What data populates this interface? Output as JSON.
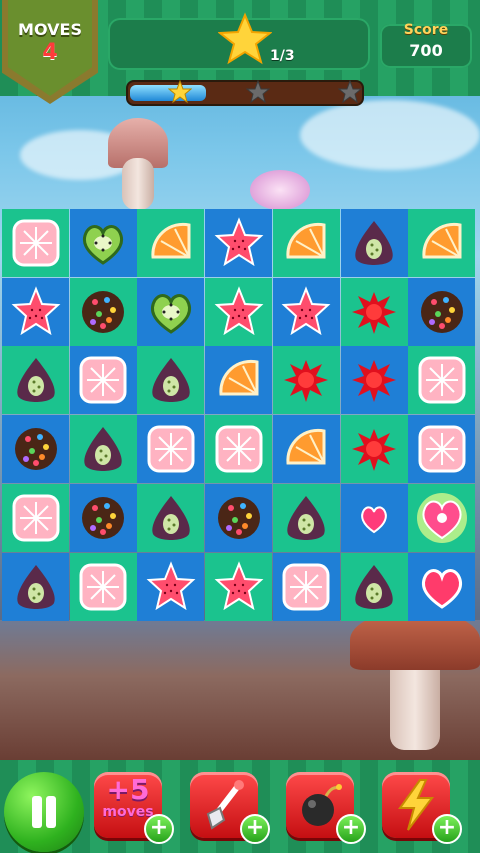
{
  "hud": {
    "moves_label": "MOVES",
    "moves_value": "4",
    "stars_text": "1/3",
    "score_label": "Score",
    "score_value": "700",
    "progress_fraction": 0.33,
    "progress_stars_earned": 1
  },
  "board": {
    "rows": [
      [
        "grapefruit",
        "kiwi-heart",
        "orange-slice",
        "star-jelly",
        "orange-slice",
        "grape-drop",
        "orange-slice"
      ],
      [
        "star-jelly",
        "choco-sprinkle",
        "kiwi-heart",
        "star-jelly",
        "star-jelly",
        "red-splat",
        "choco-sprinkle"
      ],
      [
        "grape-drop",
        "grapefruit",
        "grape-drop",
        "orange-slice",
        "red-splat",
        "red-splat",
        "grapefruit"
      ],
      [
        "choco-sprinkle",
        "grape-drop",
        "grapefruit",
        "grapefruit",
        "orange-slice",
        "red-splat",
        "grapefruit"
      ],
      [
        "grapefruit",
        "choco-sprinkle",
        "grape-drop",
        "choco-sprinkle",
        "grape-drop",
        "small-heart",
        "glowing-heart"
      ],
      [
        "grape-drop",
        "grapefruit",
        "star-jelly",
        "star-jelly",
        "grapefruit",
        "grape-drop",
        "pink-heart"
      ]
    ]
  },
  "boosters": {
    "extra_moves_amount": "+5",
    "extra_moves_label": "moves",
    "items": [
      "extra-moves",
      "shovel",
      "bomb",
      "lightning"
    ]
  },
  "colors": {
    "cell_blue": "#1f7fd6",
    "cell_green": "#1bc38e",
    "header_green": "#1f8e57",
    "booster_red": "#e02020"
  }
}
